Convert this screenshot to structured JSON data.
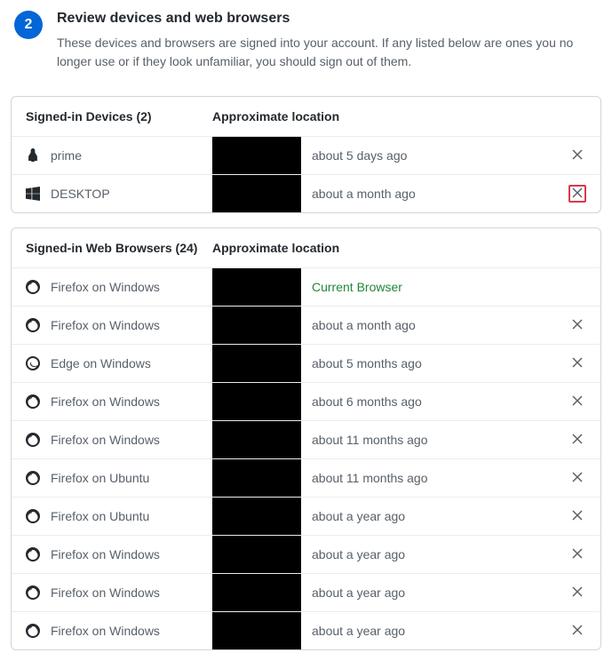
{
  "step": {
    "number": "2",
    "title": "Review devices and web browsers",
    "description": "These devices and browsers are signed into your account. If any listed below are ones you no longer use or if they look unfamiliar, you should sign out of them."
  },
  "devices_panel": {
    "header_name": "Signed-in Devices (2)",
    "header_loc": "Approximate location",
    "rows": [
      {
        "icon": "linux",
        "name": "prime",
        "time": "about 5 days ago",
        "highlighted": false
      },
      {
        "icon": "windows",
        "name": "DESKTOP",
        "time": "about a month ago",
        "highlighted": true
      }
    ]
  },
  "browsers_panel": {
    "header_name": "Signed-in Web Browsers (24)",
    "header_loc": "Approximate location",
    "rows": [
      {
        "icon": "firefox",
        "name": "Firefox on Windows",
        "time": "Current Browser",
        "current": true
      },
      {
        "icon": "firefox",
        "name": "Firefox on Windows",
        "time": "about a month ago"
      },
      {
        "icon": "edge",
        "name": "Edge on Windows",
        "time": "about 5 months ago"
      },
      {
        "icon": "firefox",
        "name": "Firefox on Windows",
        "time": "about 6 months ago"
      },
      {
        "icon": "firefox",
        "name": "Firefox on Windows",
        "time": "about 11 months ago"
      },
      {
        "icon": "firefox",
        "name": "Firefox on Ubuntu",
        "time": "about 11 months ago"
      },
      {
        "icon": "firefox",
        "name": "Firefox on Ubuntu",
        "time": "about a year ago"
      },
      {
        "icon": "firefox",
        "name": "Firefox on Windows",
        "time": "about a year ago"
      },
      {
        "icon": "firefox",
        "name": "Firefox on Windows",
        "time": "about a year ago"
      },
      {
        "icon": "firefox",
        "name": "Firefox on Windows",
        "time": "about a year ago"
      }
    ]
  }
}
